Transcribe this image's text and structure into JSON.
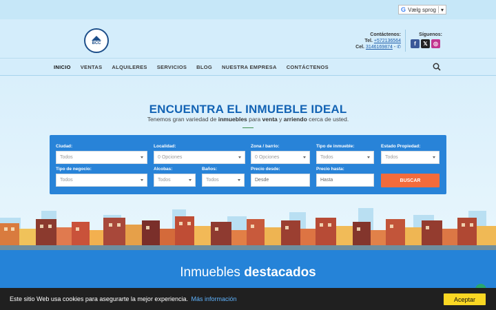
{
  "translate": {
    "label": "Vælg sprog"
  },
  "header": {
    "logo_text": "BCC",
    "contact_title": "Contáctenos:",
    "tel_label": "Tel.",
    "tel_number": "+572136564",
    "cel_label": "Cel.",
    "cel_number": "3146169874",
    "follow_label": "Síguenos:"
  },
  "nav": {
    "items": [
      "INICIO",
      "VENTAS",
      "ALQUILERES",
      "SERVICIOS",
      "BLOG",
      "NUESTRA EMPRESA",
      "CONTÁCTENOS"
    ]
  },
  "hero": {
    "title": "ENCUENTRA EL INMUEBLE IDEAL",
    "sub_pre": "Tenemos gran variedad de ",
    "sub_b1": "inmuebles",
    "sub_mid1": " para ",
    "sub_b2": "venta",
    "sub_mid2": " y ",
    "sub_b3": "arriendo",
    "sub_post": " cerca de usted."
  },
  "search": {
    "ciudad": {
      "label": "Ciudad:",
      "value": "Todos"
    },
    "localidad": {
      "label": "Localidad:",
      "value": "0 Opciones"
    },
    "zona": {
      "label": "Zona / barrio:",
      "value": "0 Opciones"
    },
    "tipo_inmueble": {
      "label": "Tipo de inmueble:",
      "value": "Todos"
    },
    "estado": {
      "label": "Estado Propiedad:",
      "value": "Todos"
    },
    "tipo_negocio": {
      "label": "Tipo de negocio:",
      "value": "Todos"
    },
    "alcobas": {
      "label": "Alcobas:",
      "value": "Todos"
    },
    "banos": {
      "label": "Baños:",
      "value": "Todos"
    },
    "precio_desde": {
      "label": "Precio desde:",
      "placeholder": "Desde"
    },
    "precio_hasta": {
      "label": "Precio hasta:",
      "placeholder": "Hasta"
    },
    "button": "BUSCAR"
  },
  "featured": {
    "title_light": "Inmuebles ",
    "title_bold": "destacados"
  },
  "cookie": {
    "message": "Este sitio Web usa cookies para asegurarte la mejor experiencia.",
    "more": "Más información",
    "accept": "Aceptar"
  },
  "colors": {
    "primary": "#2583d8",
    "accent": "#f36b3b",
    "title": "#1363b4",
    "cookie_button": "#f9d723"
  }
}
